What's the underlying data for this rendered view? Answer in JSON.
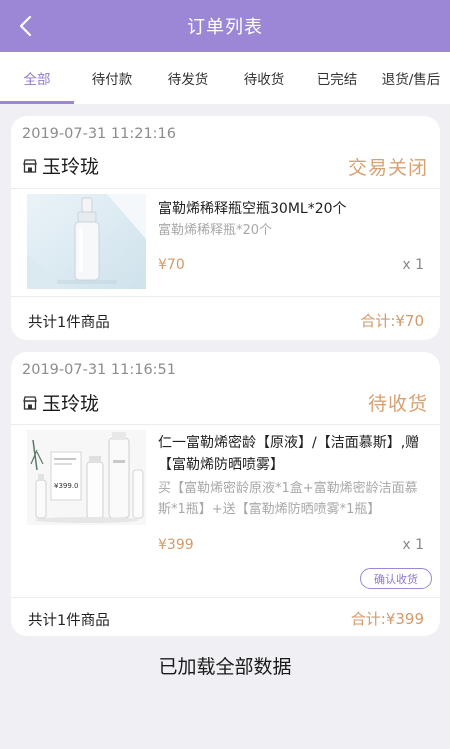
{
  "header": {
    "title": "订单列表",
    "back_icon": "chevron-left-icon"
  },
  "tabs": [
    {
      "label": "全部",
      "active": true
    },
    {
      "label": "待付款",
      "active": false
    },
    {
      "label": "待发货",
      "active": false
    },
    {
      "label": "待收货",
      "active": false
    },
    {
      "label": "已完结",
      "active": false
    },
    {
      "label": "退货/售后",
      "active": false
    }
  ],
  "orders": [
    {
      "time": "2019-07-31 11:21:16",
      "store_name": "玉玲珑",
      "status": "交易关闭",
      "product_name": "富勒烯稀释瓶空瓶30ML*20个",
      "product_spec": "富勒烯稀释瓶*20个",
      "price": "¥70",
      "qty": "x 1",
      "count_text": "共计1件商品",
      "total": "合计:¥70"
    },
    {
      "time": "2019-07-31 11:16:51",
      "store_name": "玉玲珑",
      "status": "待收货",
      "product_name": "仁一富勒烯密龄【原液】/【洁面慕斯】,赠【富勒烯防晒喷雾】",
      "product_spec": "买【富勒烯密龄原液*1盒+富勒烯密龄洁面慕斯*1瓶】+送【富勒烯防晒喷雾*1瓶】",
      "price": "¥399",
      "qty": "x 1",
      "action_label": "确认收货",
      "count_text": "共计1件商品",
      "total": "合计:¥399",
      "thumb_price": "¥399.0"
    }
  ],
  "footer": {
    "message": "已加载全部数据"
  },
  "colors": {
    "accent": "#9b87d6",
    "price": "#d39a6a",
    "background": "#f0eff4"
  }
}
